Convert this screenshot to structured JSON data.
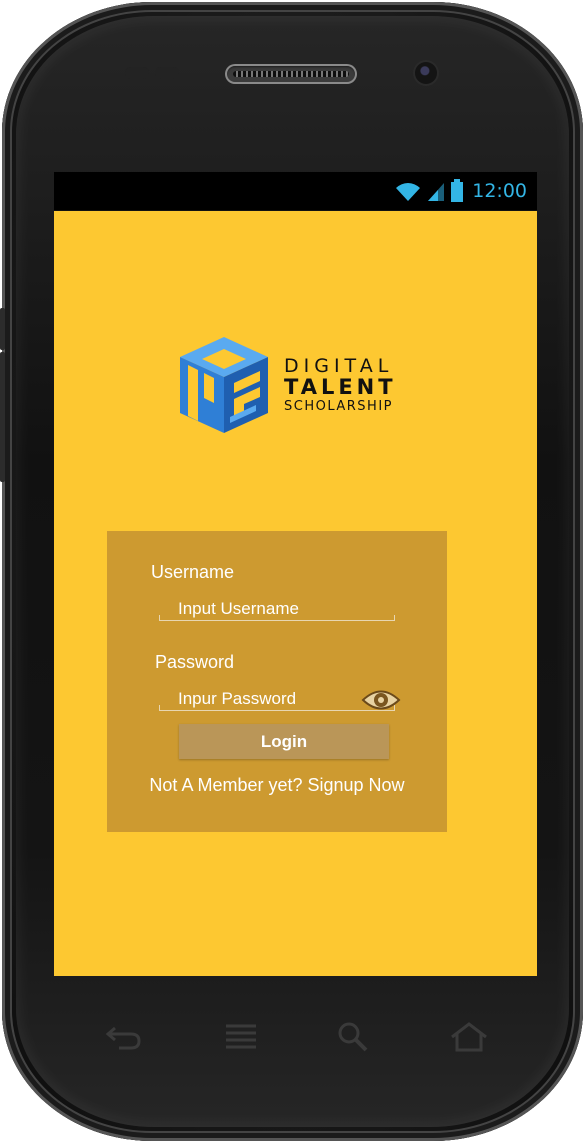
{
  "status_bar": {
    "time": "12:00",
    "icons": [
      "wifi-icon",
      "signal-icon",
      "battery-icon"
    ],
    "accent": "#33b5e5"
  },
  "logo": {
    "line1": "DIGITAL",
    "line2": "TALENT",
    "line3": "SCHOLARSHIP"
  },
  "form": {
    "username_label": "Username",
    "username_placeholder": "Input Username",
    "password_label": "Password",
    "password_placeholder": "Inpur Password",
    "login_label": "Login",
    "signup_text": "Not A Member yet? Signup Now"
  },
  "nav_buttons": [
    "back-icon",
    "menu-icon",
    "search-icon",
    "home-icon"
  ],
  "colors": {
    "screen_bg": "#fdc831",
    "card_bg": "#cd9a30",
    "button_bg": "#ba9658",
    "logo_blue": "#3a8de0"
  }
}
